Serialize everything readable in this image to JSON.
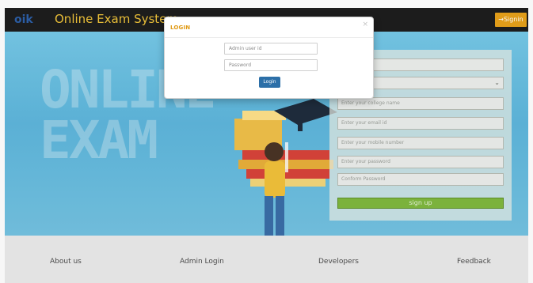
{
  "header": {
    "logo_text": "oik",
    "site_title": "Online Exam System",
    "signin_label": "→Signin"
  },
  "hero": {
    "line1": "ONLINE",
    "line2": "EXAM"
  },
  "signup": {
    "fields": [
      "",
      "",
      "Enter your college name",
      "Enter your email id",
      "Enter your mobile number",
      "Enter your password",
      "Conform Password"
    ],
    "submit_label": "sign up"
  },
  "login_modal": {
    "title": "LOGIN",
    "close_glyph": "×",
    "user_placeholder": "Admin user id",
    "password_placeholder": "Password",
    "submit_label": "Login"
  },
  "footer": {
    "links": [
      "About us",
      "Admin Login",
      "Developers",
      "Feedback"
    ]
  },
  "colors": {
    "header_bg": "#1d1d1d",
    "title_yellow": "#f0c43a",
    "signin_orange": "#e8a21a",
    "hero_blue": "#5eb6dc",
    "signup_green": "#7fb83e",
    "login_blue": "#2c6fa8",
    "footer_gray": "#e3e3e3"
  }
}
